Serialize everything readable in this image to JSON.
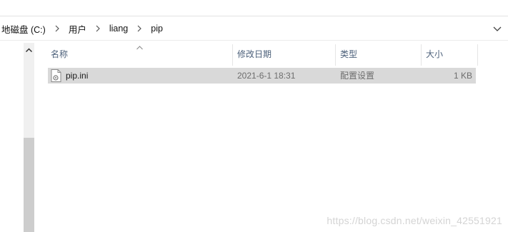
{
  "address_bar": {
    "crumbs": [
      "地磁盘 (C:)",
      "用户",
      "liang",
      "pip"
    ]
  },
  "columns": {
    "name": "名称",
    "date_modified": "修改日期",
    "type": "类型",
    "size": "大小"
  },
  "files": [
    {
      "name": "pip.ini",
      "date_modified": "2021-6-1 18:31",
      "type": "配置设置",
      "size": "1 KB",
      "icon": "ini-settings-file-icon",
      "selected": true
    }
  ],
  "watermark": "https://blog.csdn.net/weixin_42551921",
  "colors": {
    "selected_row": "#d9d9d9",
    "header_text": "#4c607a"
  }
}
